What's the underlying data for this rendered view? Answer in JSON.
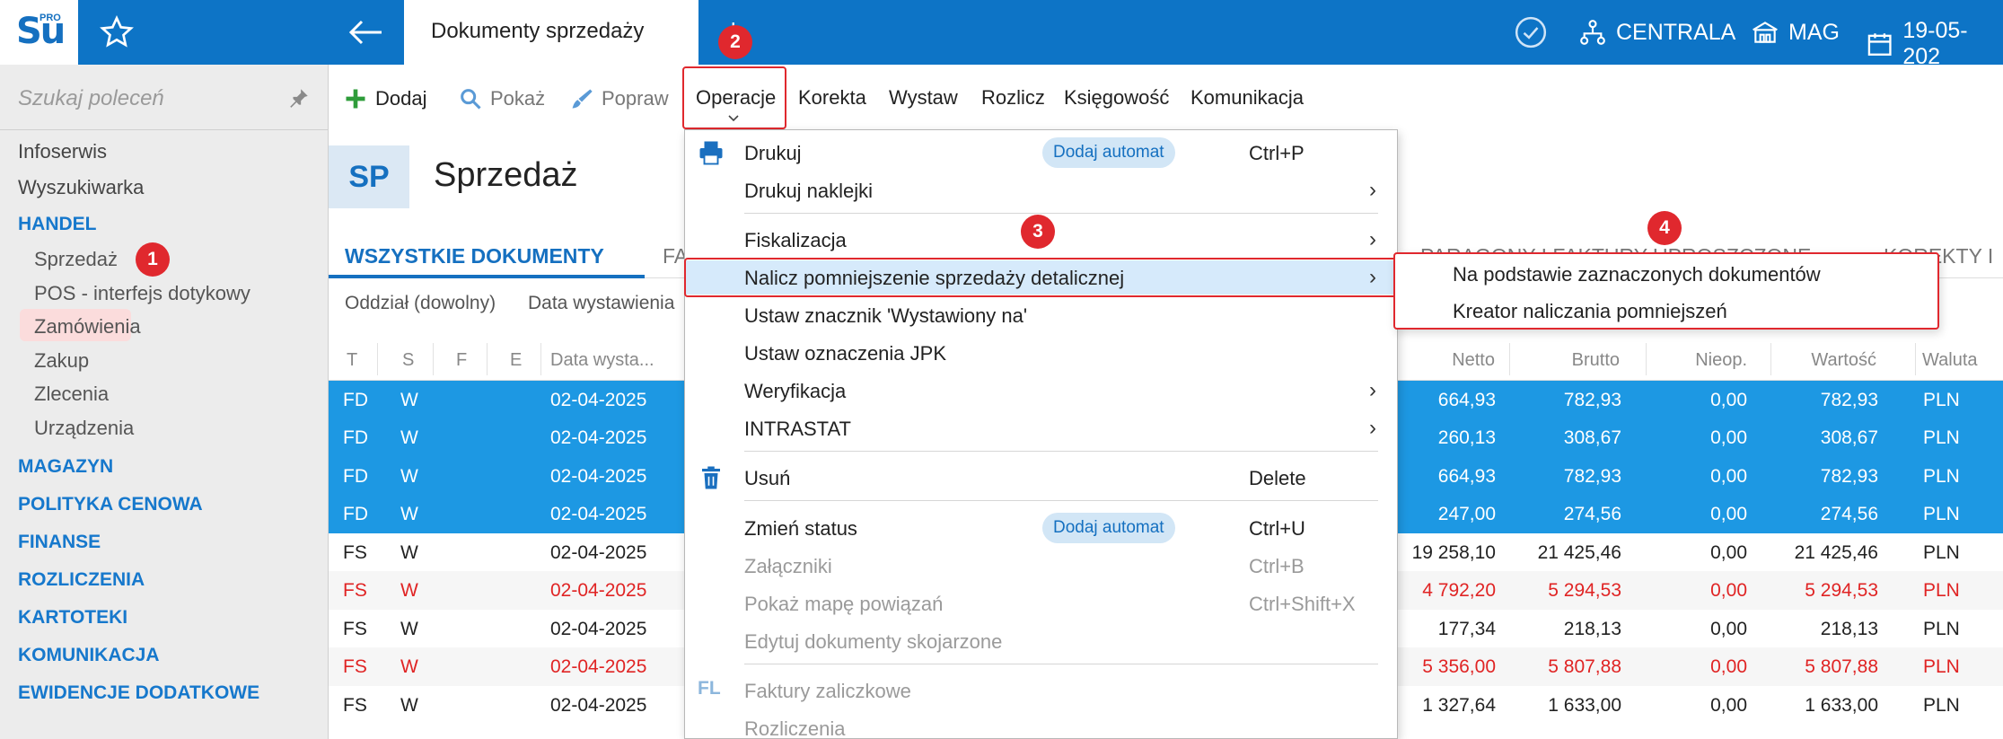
{
  "app": {
    "logo_text": "Su",
    "logo_sup": "PRO"
  },
  "topbar": {
    "active_tab": "Dokumenty sprzedaży",
    "new_tab": "+",
    "centrala": "CENTRALA",
    "mag": "MAG",
    "date": "19-05-202"
  },
  "toolbar": {
    "dodaj": "Dodaj",
    "pokaz": "Pokaż",
    "popraw": "Popraw",
    "operacje": "Operacje",
    "korekta": "Korekta",
    "wystaw": "Wystaw",
    "rozlicz": "Rozlicz",
    "ksiegowosc": "Księgowość",
    "komunikacja": "Komunikacja"
  },
  "sidebar": {
    "search_placeholder": "Szukaj poleceń",
    "items": [
      "Infoserwis",
      "Wyszukiwarka"
    ],
    "handel": "HANDEL",
    "handel_sub": [
      "Sprzedaż",
      "POS - interfejs dotykowy",
      "Zamówienia",
      "Zakup",
      "Zlecenia",
      "Urządzenia"
    ],
    "sections": [
      "MAGAZYN",
      "POLITYKA CENOWA",
      "FINANSE",
      "ROZLICZENIA",
      "KARTOTEKI",
      "KOMUNIKACJA",
      "EWIDENCJE DODATKOWE"
    ]
  },
  "main": {
    "badge": "SP",
    "title": "Sprzedaż",
    "tabs": [
      "WSZYSTKIE DOKUMENTY",
      "FA",
      "PARAGONY I FAKTURY UPROSZCZONE",
      "KOREKTY I Z"
    ],
    "filter_1": "Oddział (dowolny)",
    "filter_2": "Data wystawienia",
    "columns": [
      "T",
      "S",
      "F",
      "E",
      "Data wysta...",
      "Netto",
      "Brutto",
      "Nieop.",
      "Wartość",
      "Waluta"
    ],
    "rows": [
      {
        "t": "FD",
        "s": "W",
        "date": "02-04-2025",
        "netto": "664,93",
        "brutto": "782,93",
        "nieop": "0,00",
        "wartosc": "782,93",
        "waluta": "PLN"
      },
      {
        "t": "FD",
        "s": "W",
        "date": "02-04-2025",
        "netto": "260,13",
        "brutto": "308,67",
        "nieop": "0,00",
        "wartosc": "308,67",
        "waluta": "PLN"
      },
      {
        "t": "FD",
        "s": "W",
        "date": "02-04-2025",
        "netto": "664,93",
        "brutto": "782,93",
        "nieop": "0,00",
        "wartosc": "782,93",
        "waluta": "PLN"
      },
      {
        "t": "FD",
        "s": "W",
        "date": "02-04-2025",
        "netto": "247,00",
        "brutto": "274,56",
        "nieop": "0,00",
        "wartosc": "274,56",
        "waluta": "PLN"
      },
      {
        "t": "FS",
        "s": "W",
        "date": "02-04-2025",
        "netto": "19 258,10",
        "brutto": "21 425,46",
        "nieop": "0,00",
        "wartosc": "21 425,46",
        "waluta": "PLN"
      },
      {
        "t": "FS",
        "s": "W",
        "date": "02-04-2025",
        "netto": "4 792,20",
        "brutto": "5 294,53",
        "nieop": "0,00",
        "wartosc": "5 294,53",
        "waluta": "PLN"
      },
      {
        "t": "FS",
        "s": "W",
        "date": "02-04-2025",
        "netto": "177,34",
        "brutto": "218,13",
        "nieop": "0,00",
        "wartosc": "218,13",
        "waluta": "PLN"
      },
      {
        "t": "FS",
        "s": "W",
        "date": "02-04-2025",
        "netto": "5 356,00",
        "brutto": "5 807,88",
        "nieop": "0,00",
        "wartosc": "5 807,88",
        "waluta": "PLN"
      },
      {
        "t": "FS",
        "s": "W",
        "date": "02-04-2025",
        "netto": "1 327,64",
        "brutto": "1 633,00",
        "nieop": "0,00",
        "wartosc": "1 633,00",
        "waluta": "PLN"
      }
    ]
  },
  "menu": {
    "drukuj": "Drukuj",
    "dodaj_automat": "Dodaj automat",
    "drukuj_sc": "Ctrl+P",
    "drukuj_naklejki": "Drukuj naklejki",
    "fiskalizacja": "Fiskalizacja",
    "nalicz": "Nalicz pomniejszenie sprzedaży detalicznej",
    "ustaw_znacznik": "Ustaw znacznik 'Wystawiony na'",
    "ustaw_jpk": "Ustaw oznaczenia JPK",
    "weryfikacja": "Weryfikacja",
    "intrastat": "INTRASTAT",
    "usun": "Usuń",
    "usun_sc": "Delete",
    "zmien_status": "Zmień status",
    "zmien_sc": "Ctrl+U",
    "zalaczniki": "Załączniki",
    "zalaczniki_sc": "Ctrl+B",
    "pokaz_mape": "Pokaż mapę powiązań",
    "pokaz_mape_sc": "Ctrl+Shift+X",
    "edytuj": "Edytuj dokumenty skojarzone",
    "fl_badge": "FL",
    "faktury_zal": "Faktury zaliczkowe",
    "rozliczenia": "Rozliczenia",
    "arrow": "›"
  },
  "submenu": {
    "item_1": "Na podstawie zaznaczonych dokumentów",
    "item_2": "Kreator naliczania pomniejszeń"
  },
  "steps": [
    "1",
    "2",
    "3",
    "4"
  ],
  "colors": {
    "brand": "#0d74c6",
    "accent": "#1570c0",
    "selected_row": "#1d98e3",
    "highlight_red": "#e0282e",
    "negative": "#e02424"
  }
}
